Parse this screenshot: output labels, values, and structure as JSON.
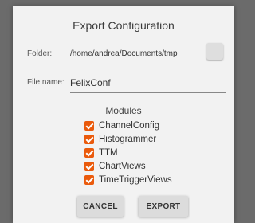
{
  "dialog": {
    "title": "Export Configuration",
    "folder_label": "Folder:",
    "folder_value": "/home/andrea/Documents/tmp",
    "browse_label": "...",
    "filename_label": "File name:",
    "filename_value": "FelixConf",
    "modules_heading": "Modules",
    "modules": [
      {
        "label": "ChannelConfig",
        "checked": true
      },
      {
        "label": "Histogrammer",
        "checked": true
      },
      {
        "label": "TTM",
        "checked": true
      },
      {
        "label": "ChartViews",
        "checked": true
      },
      {
        "label": "TimeTriggerViews",
        "checked": true
      }
    ],
    "cancel_label": "CANCEL",
    "export_label": "EXPORT"
  },
  "colors": {
    "accent": "#ea5a0c",
    "backdrop": "#6b6b6b",
    "dialog_bg": "#f2f2f2"
  }
}
